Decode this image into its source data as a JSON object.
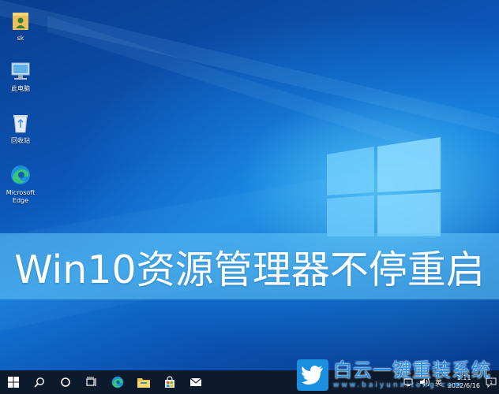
{
  "desktop_icons": [
    {
      "name": "user-folder",
      "label": "sk",
      "icon": "user-folder-icon"
    },
    {
      "name": "this-pc",
      "label": "此电脑",
      "icon": "computer-icon"
    },
    {
      "name": "recycle-bin",
      "label": "回收站",
      "icon": "recycle-bin-icon"
    },
    {
      "name": "edge",
      "label": "Microsoft Edge",
      "icon": "edge-icon"
    }
  ],
  "banner": {
    "title": "Win10资源管理器不停重启"
  },
  "taskbar": {
    "buttons": [
      "windows-start-icon",
      "search-icon",
      "cortana-icon",
      "task-view-icon",
      "edge-icon",
      "file-explorer-icon",
      "store-icon",
      "mail-icon"
    ],
    "tray": {
      "ime": "英",
      "time": "1:11",
      "date": "2022/6/16",
      "notification_count": "1"
    }
  },
  "watermark": {
    "title": "白云一键重装系统",
    "url": "www.baiyunxitong.com"
  },
  "colors": {
    "taskbar": "#0d1a2b",
    "banner": "#64c8f5",
    "watermark": "#1e90e8"
  }
}
